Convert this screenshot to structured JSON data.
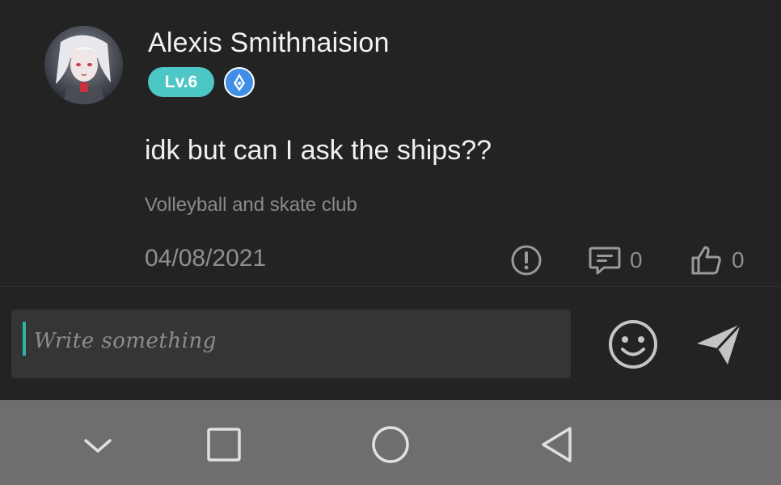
{
  "post": {
    "username": "Alexis Smithnaision",
    "level": "Lv.6",
    "message": "idk but can I ask the ships??",
    "community": "Volleyball and skate club",
    "date": "04/08/2021",
    "comment_count": "0",
    "like_count": "0"
  },
  "composer": {
    "placeholder": "Write something"
  },
  "colors": {
    "background": "#232323",
    "level_badge": "#4dc6c6",
    "title_badge": "#3f8fe6",
    "cursor": "#2fb3a6",
    "navbar": "#6e6e6e"
  },
  "icons": {
    "report": "exclamation-circle-icon",
    "comment": "comment-bubble-icon",
    "like": "thumbs-up-icon",
    "emoji": "smiley-icon",
    "send": "paper-plane-icon",
    "nav_hide": "chevron-down-icon",
    "nav_recent": "square-icon",
    "nav_home": "circle-icon",
    "nav_back": "triangle-back-icon"
  }
}
